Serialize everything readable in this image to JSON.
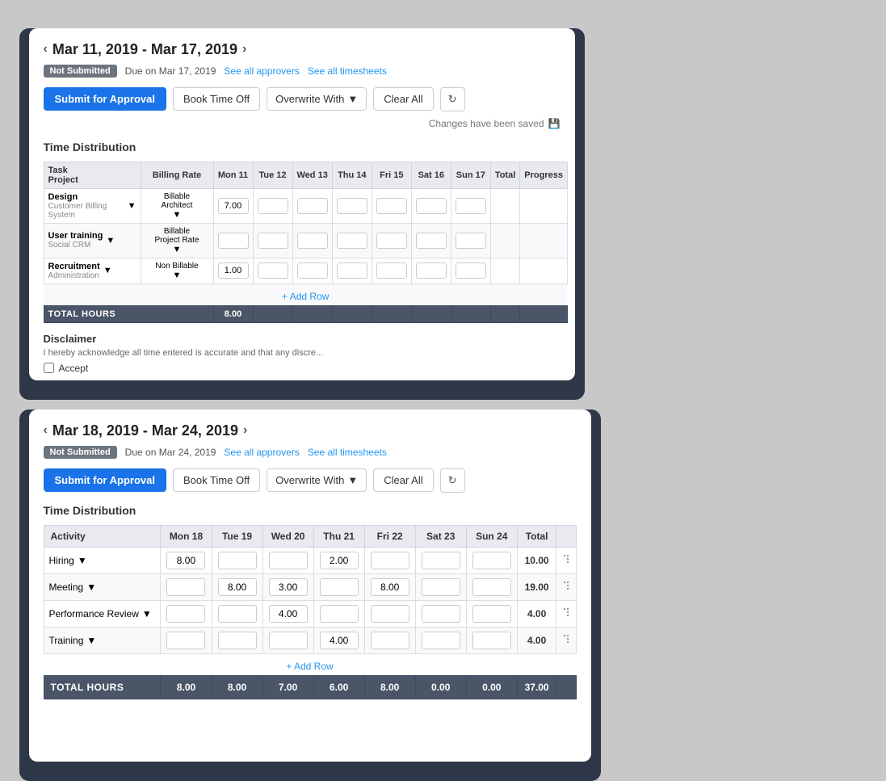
{
  "back_card": {
    "date_range": "Mar 11, 2019 - Mar 17, 2019",
    "status": "Not Submitted",
    "due": "Due on Mar 17, 2019",
    "see_approvers": "See all approvers",
    "see_timesheets": "See all timesheets",
    "submit_label": "Submit for Approval",
    "book_time_off": "Book Time Off",
    "overwrite_with": "Overwrite With",
    "clear_all": "Clear All",
    "saved_text": "Changes have been saved",
    "section_title": "Time Distribution",
    "columns": [
      "Task / Project",
      "Billing Rate",
      "Mon 11",
      "Tue 12",
      "Wed 13",
      "Thu 14",
      "Fri 15",
      "Sat 16",
      "Sun 17",
      "Total",
      "Progress"
    ],
    "rows": [
      {
        "task": "Design",
        "project": "Customer Billing System",
        "billing": "Billable Architect",
        "mon": "7.00",
        "tue": "",
        "wed": "",
        "thu": "",
        "fri": "",
        "sat": "",
        "sun": "",
        "total": ""
      },
      {
        "task": "User training",
        "project": "Social CRM",
        "billing": "Billable Project Rate",
        "mon": "",
        "tue": "",
        "wed": "",
        "thu": "",
        "fri": "",
        "sat": "",
        "sun": "",
        "total": ""
      },
      {
        "task": "Recruitment",
        "project": "Administration",
        "billing": "Non Billable",
        "mon": "1.00",
        "tue": "",
        "wed": "",
        "thu": "",
        "fri": "",
        "sat": "",
        "sun": "",
        "total": ""
      }
    ],
    "add_row": "+ Add Row",
    "total_label": "TOTAL HOURS",
    "total_values": [
      "8.00",
      "",
      "",
      "",
      "",
      "",
      ""
    ],
    "disclaimer_title": "Disclaimer",
    "disclaimer_text": "I hereby acknowledge all time entered is accurate and that any discre...",
    "accept_label": "Accept"
  },
  "front_card": {
    "date_range": "Mar 18, 2019 - Mar 24, 2019",
    "status": "Not Submitted",
    "due": "Due on Mar 24, 2019",
    "see_approvers": "See all approvers",
    "see_timesheets": "See all timesheets",
    "submit_label": "Submit for Approval",
    "book_time_off": "Book Time Off",
    "overwrite_with": "Overwrite With",
    "clear_all": "Clear All",
    "section_title": "Time Distribution",
    "columns": [
      "Activity",
      "Mon 18",
      "Tue 19",
      "Wed 20",
      "Thu 21",
      "Fri 22",
      "Sat 23",
      "Sun 24",
      "Total"
    ],
    "rows": [
      {
        "activity": "Hiring",
        "mon": "8.00",
        "tue": "",
        "wed": "",
        "thu": "2.00",
        "fri": "",
        "sat": "",
        "sun": "",
        "total": "10.00"
      },
      {
        "activity": "Meeting",
        "mon": "",
        "tue": "8.00",
        "wed": "3.00",
        "thu": "",
        "fri": "8.00",
        "sat": "",
        "sun": "",
        "total": "19.00"
      },
      {
        "activity": "Performance Review",
        "mon": "",
        "tue": "",
        "wed": "4.00",
        "thu": "",
        "fri": "",
        "sat": "",
        "sun": "",
        "total": "4.00"
      },
      {
        "activity": "Training",
        "mon": "",
        "tue": "",
        "wed": "",
        "thu": "4.00",
        "fri": "",
        "sat": "",
        "sun": "",
        "total": "4.00"
      }
    ],
    "add_row": "+ Add Row",
    "total_label": "TOTAL HOURS",
    "total_values": [
      "8.00",
      "8.00",
      "7.00",
      "6.00",
      "8.00",
      "0.00",
      "0.00",
      "37.00"
    ]
  }
}
